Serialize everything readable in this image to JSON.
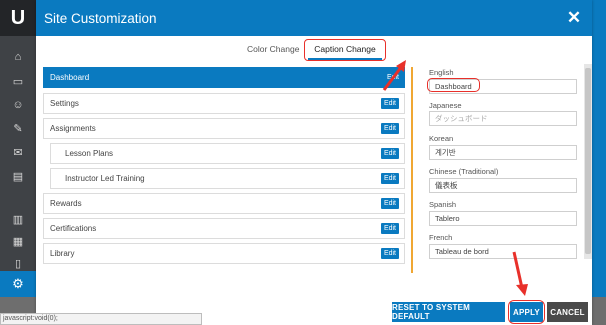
{
  "background": {
    "logo_text": "U",
    "sidebar_icons": [
      "home-icon",
      "presentation-icon",
      "users-icon",
      "tools-icon",
      "inbox-icon",
      "reports-icon",
      "chart-icon",
      "calendar-icon",
      "mobile-icon",
      "gear-icon",
      "pie-icon"
    ]
  },
  "statusbar": {
    "text": "javascript:void(0);"
  },
  "modal": {
    "title": "Site Customization",
    "close_icon": "close-icon",
    "tabs": {
      "color_change": "Color Change",
      "caption_change": "Caption Change"
    },
    "items": [
      {
        "label": "Dashboard",
        "edit": "Edit",
        "selected": true,
        "indent": false
      },
      {
        "label": "Settings",
        "edit": "Edit",
        "selected": false,
        "indent": false
      },
      {
        "label": "Assignments",
        "edit": "Edit",
        "selected": false,
        "indent": false
      },
      {
        "label": "Lesson Plans",
        "edit": "Edit",
        "selected": false,
        "indent": true
      },
      {
        "label": "Instructor Led Training",
        "edit": "Edit",
        "selected": false,
        "indent": true
      },
      {
        "label": "Rewards",
        "edit": "Edit",
        "selected": false,
        "indent": false
      },
      {
        "label": "Certifications",
        "edit": "Edit",
        "selected": false,
        "indent": false
      },
      {
        "label": "Library",
        "edit": "Edit",
        "selected": false,
        "indent": false
      }
    ],
    "languages": [
      {
        "label": "English",
        "value": "Dashboard",
        "placeholder": false
      },
      {
        "label": "Japanese",
        "value": "ダッシュボード",
        "placeholder": true
      },
      {
        "label": "Korean",
        "value": "계기반",
        "placeholder": false
      },
      {
        "label": "Chinese (Traditional)",
        "value": "儀表板",
        "placeholder": false
      },
      {
        "label": "Spanish",
        "value": "Tablero",
        "placeholder": false
      },
      {
        "label": "French",
        "value": "Tableau de bord",
        "placeholder": false
      }
    ],
    "buttons": {
      "reset": "RESET TO SYSTEM DEFAULT",
      "apply": "APPLY",
      "cancel": "CANCEL"
    }
  },
  "colors": {
    "brand_blue": "#0a7ac0",
    "accent_orange": "#f0a733",
    "annotation_red": "#e8302a"
  }
}
